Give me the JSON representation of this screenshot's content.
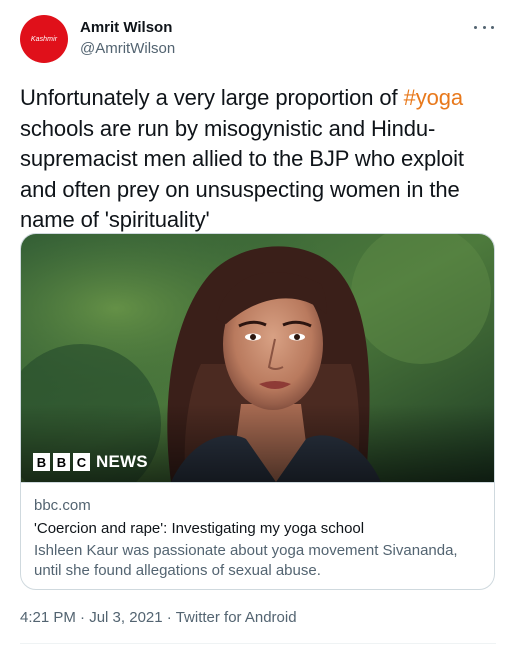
{
  "author": {
    "avatar_text": "Kashmir",
    "name": "Amrit Wilson",
    "handle": "@AmritWilson"
  },
  "tweet": {
    "text_before": "Unfortunately a very large proportion of ",
    "hashtag": "#yoga",
    "text_after": " schools are run by misogynistic and Hindu-supremacist men allied to the BJP who exploit and often prey on unsuspecting women in the name of 'spirituality'"
  },
  "card": {
    "image_logo_boxes": [
      "B",
      "B",
      "C"
    ],
    "image_logo_word": "NEWS",
    "domain": "bbc.com",
    "title": "'Coercion and rape': Investigating my yoga school",
    "description": "Ishleen Kaur was passionate about yoga movement Sivananda, until she found allegations of sexual abuse."
  },
  "meta": {
    "time": "4:21 PM",
    "separator": "·",
    "date": "Jul 3, 2021",
    "source": "Twitter for Android"
  },
  "colors": {
    "avatar_bg": "#e0101a",
    "hashtag": "#e8791c",
    "secondary_text": "#536471",
    "border": "#cfd9de"
  },
  "icons": {
    "more": "more-horizontal-icon"
  }
}
